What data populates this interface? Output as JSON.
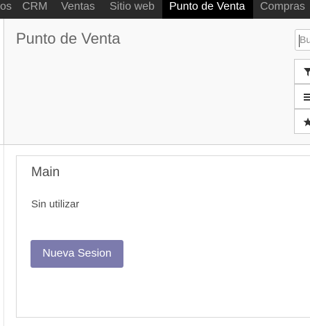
{
  "navbar": {
    "items": [
      {
        "label": "os"
      },
      {
        "label": "CRM"
      },
      {
        "label": "Ventas"
      },
      {
        "label": "Sitio web"
      },
      {
        "label": "Punto de Venta",
        "active": true
      },
      {
        "label": "Compras"
      }
    ]
  },
  "control_panel": {
    "title": "Punto de Venta",
    "search_partial": "Bu",
    "buttons": [
      {
        "icon": "filter-icon"
      },
      {
        "icon": "group-by-icon"
      },
      {
        "icon": "favorite-star-icon"
      }
    ]
  },
  "dashboard": {
    "card": {
      "title": "Main",
      "status": "Sin utilizar",
      "button_label": "Nueva Sesion"
    }
  },
  "colors": {
    "navbar_bg": "#2a2a2a",
    "navbar_active_bg": "#000000",
    "accent": "#7c7bad"
  }
}
